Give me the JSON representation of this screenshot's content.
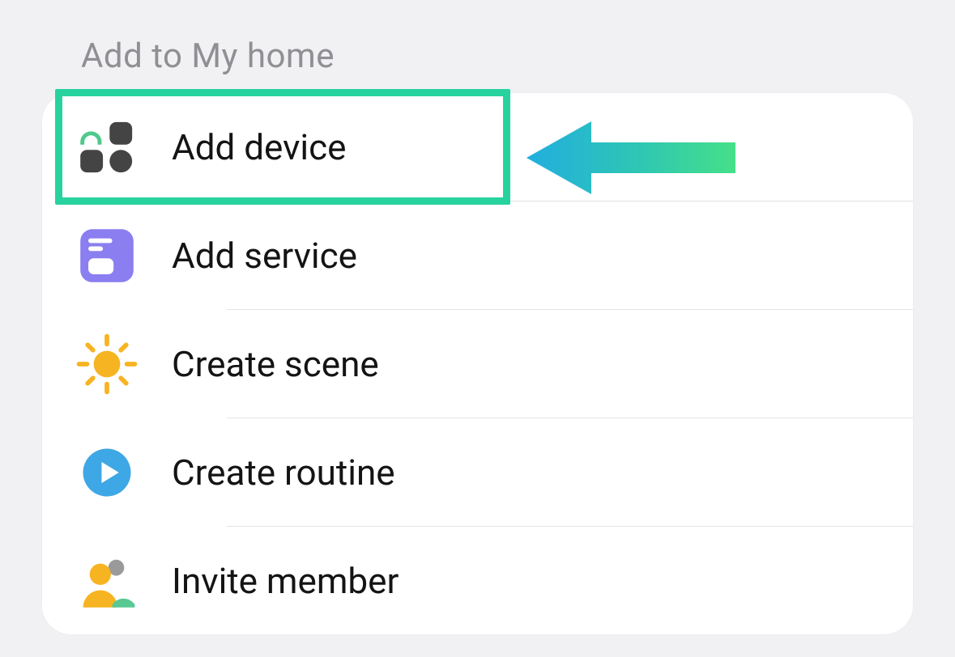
{
  "section_title": "Add to My home",
  "menu": {
    "items": [
      {
        "label": "Add device"
      },
      {
        "label": "Add service"
      },
      {
        "label": "Create scene"
      },
      {
        "label": "Create routine"
      },
      {
        "label": "Invite member"
      }
    ]
  }
}
